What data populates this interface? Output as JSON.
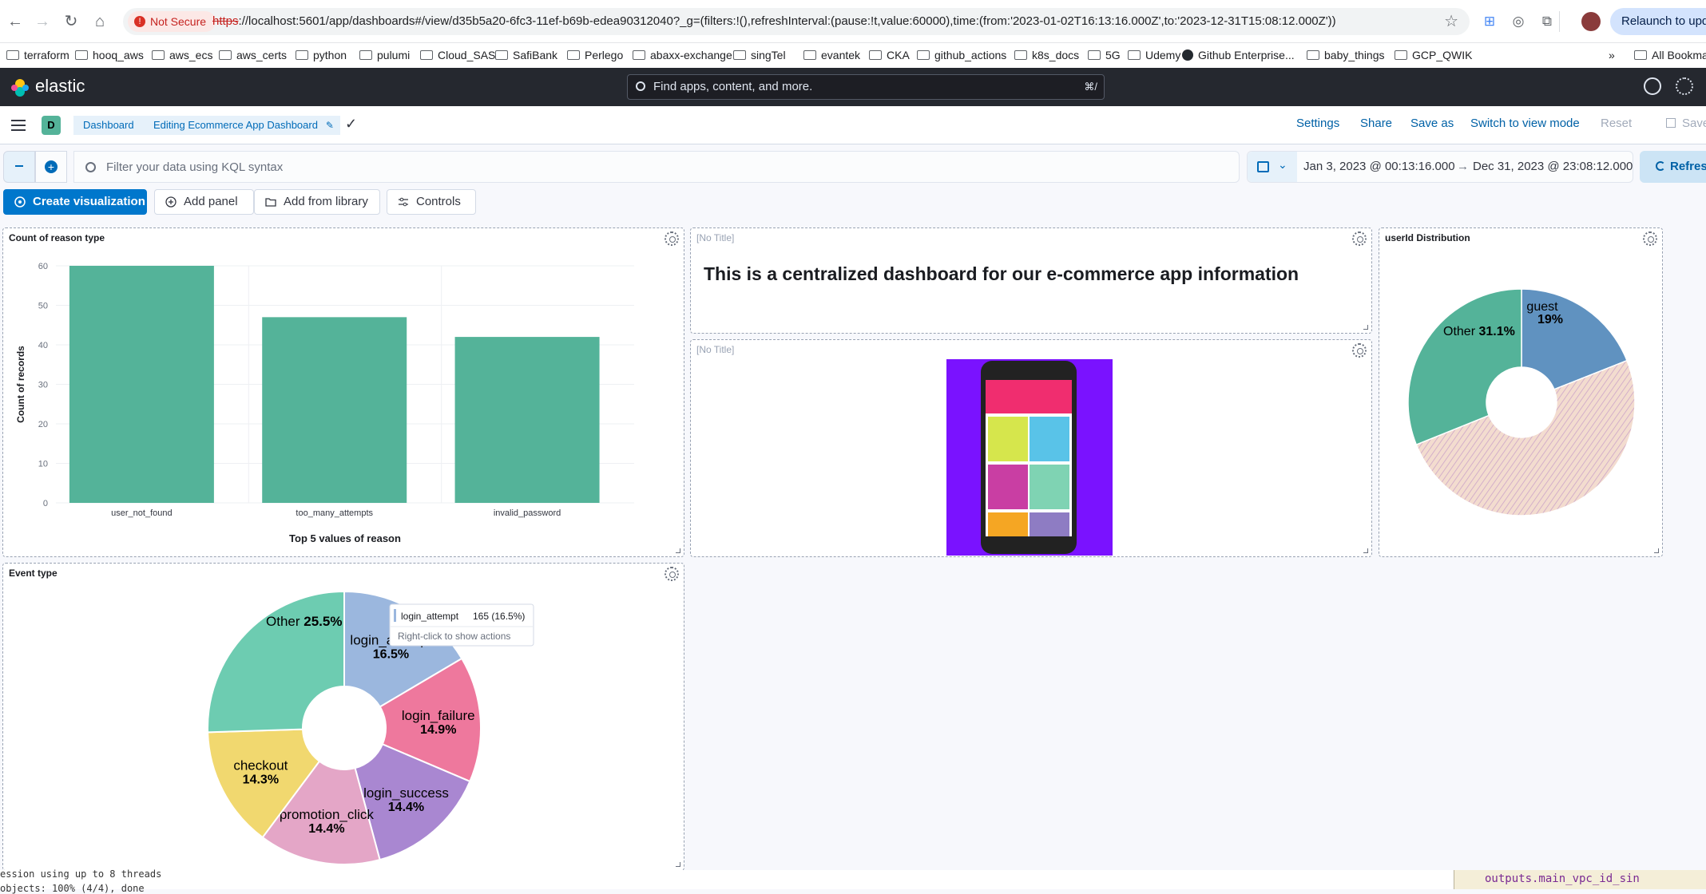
{
  "browser": {
    "security_label": "Not Secure",
    "url_scheme": "https",
    "url_rest": "://localhost:5601/app/dashboards#/view/d35b5a20-6fc3-11ef-b69b-edea90312040?_g=(filters:!(),refreshInterval:(pause:!t,value:60000),time:(from:'2023-01-02T16:13:16.000Z',to:'2023-12-31T15:08:12.000Z'))",
    "relaunch_label": "Relaunch to update",
    "more_bookmarks": "»",
    "all_bookmarks": "All Bookmarks"
  },
  "bookmarks": [
    "terraform",
    "hooq_aws",
    "aws_ecs",
    "aws_certs",
    "python",
    "pulumi",
    "Cloud_SAS",
    "SafiBank",
    "Perlego",
    "abaxx-exchange",
    "singTel",
    "evantek",
    "CKA",
    "github_actions",
    "k8s_docs",
    "5G",
    "Udemy",
    "Github Enterprise...",
    "baby_things",
    "GCP_QWIK"
  ],
  "kibana": {
    "brand": "elastic",
    "search_placeholder": "Find apps, content, and more.",
    "search_shortcut": "⌘/"
  },
  "app_bar": {
    "space_initial": "D",
    "breadcrumb_root": "Dashboard",
    "breadcrumb_current": "Editing Ecommerce App Dashboard",
    "settings": "Settings",
    "share": "Share",
    "save_as": "Save as",
    "switch_view": "Switch to view mode",
    "reset": "Reset",
    "save": "Save"
  },
  "query": {
    "placeholder": "Filter your data using KQL syntax",
    "date_start": "Jan 3, 2023 @ 00:13:16.000",
    "date_arrow": "→",
    "date_end": "Dec 31, 2023 @ 23:08:12.000",
    "refresh": "Refresh"
  },
  "controls": {
    "create_visualization": "Create visualization",
    "add_panel": "Add panel",
    "add_from_library": "Add from library",
    "controls": "Controls"
  },
  "panels": {
    "reason": {
      "title": "Count of reason type"
    },
    "markdown": {
      "title": "[No Title]",
      "text": "This is a centralized dashboard for our e-commerce app information"
    },
    "image": {
      "title": "[No Title]"
    },
    "userid": {
      "title": "userId Distribution"
    },
    "event": {
      "title": "Event type"
    }
  },
  "tooltip": {
    "label": "login_attempt",
    "value": "165 (16.5%)",
    "hint": "Right-click to show actions"
  },
  "chart_data": [
    {
      "type": "bar",
      "title": "Count of reason type",
      "categories": [
        "user_not_found",
        "too_many_attempts",
        "invalid_password"
      ],
      "values": [
        60,
        47,
        42
      ],
      "xlabel": "Top 5 values of reason",
      "ylabel": "Count of records",
      "ylim": [
        0,
        60
      ],
      "yticks": [
        0,
        10,
        20,
        30,
        40,
        50,
        60
      ],
      "color": "#54b399",
      "grid": true
    },
    {
      "type": "pie",
      "title": "userId Distribution",
      "donut": true,
      "slices": [
        {
          "label": "guest",
          "pct_label": "19%",
          "value": 19,
          "color": "#6092c0"
        },
        {
          "label": "",
          "pct_label": "",
          "value": 49.9,
          "color": "#e6c2b3",
          "striped": true
        },
        {
          "label": "Other",
          "pct_label": "31.1%",
          "value": 31.1,
          "color": "#54b399"
        }
      ]
    },
    {
      "type": "pie",
      "title": "Event type",
      "donut": true,
      "slices": [
        {
          "label": "login_attempt",
          "pct_label": "16.5%",
          "value": 16.5,
          "color": "#9bb7de"
        },
        {
          "label": "login_failure",
          "pct_label": "14.9%",
          "value": 14.9,
          "color": "#ee789d"
        },
        {
          "label": "login_success",
          "pct_label": "14.4%",
          "value": 14.4,
          "color": "#a987d1"
        },
        {
          "label": "promotion_click",
          "pct_label": "14.4%",
          "value": 14.4,
          "color": "#e4a6c7"
        },
        {
          "label": "checkout",
          "pct_label": "14.3%",
          "value": 14.3,
          "color": "#f1d86f"
        },
        {
          "label": "Other",
          "pct_label": "25.5%",
          "value": 25.5,
          "color": "#6dccb1"
        }
      ]
    }
  ],
  "terminal": {
    "line1": "ession using up to 8 threads",
    "line2": "objects: 100% (4/4), done",
    "right": "outputs.main_vpc_id_sin"
  }
}
